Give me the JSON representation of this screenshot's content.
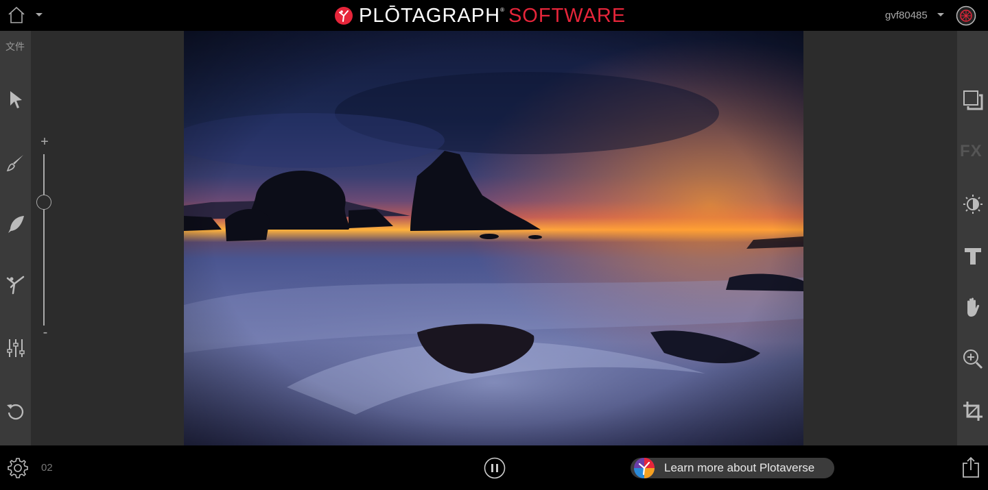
{
  "header": {
    "logo_word": "PLŌTAGRAPH",
    "logo_reg": "®",
    "logo_word2": "SOFTWARE",
    "username": "gvf80485"
  },
  "left_toolbar": {
    "file_label": "文件",
    "tools": [
      "select-tool",
      "brush-tool",
      "feather-tool",
      "animate-tool",
      "adjust-tool",
      "reset-tool"
    ]
  },
  "zoom": {
    "plus": "+",
    "minus": "-",
    "level": 0.72
  },
  "right_toolbar": {
    "fx_label": "FX",
    "tools": [
      "layers-tool",
      "fx-tool",
      "brightness-tool",
      "text-tool",
      "pan-tool",
      "zoom-tool",
      "crop-tool"
    ]
  },
  "footer": {
    "frame_count": "02",
    "learn_label": "Learn more about Plotaverse"
  },
  "colors": {
    "accent": "#e6253a",
    "toolbar": "#3a3a3a",
    "canvas": "#2c2c2c"
  }
}
